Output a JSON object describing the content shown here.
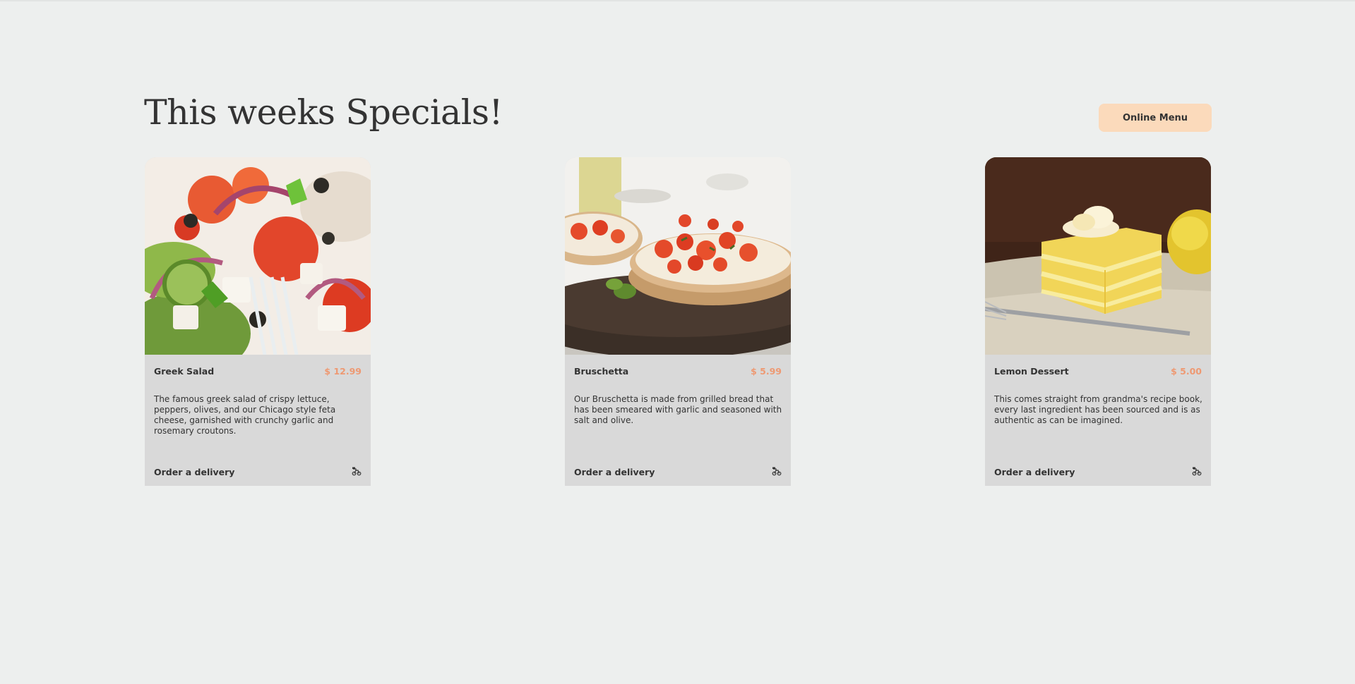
{
  "colors": {
    "page_bg": "#edefee",
    "accent_price": "#ee9972",
    "button_bg": "#fbdabb",
    "card_bg": "#d9d9d9",
    "text": "#333333"
  },
  "specials": {
    "title": "This weeks Specials!",
    "menu_button_label": "Online Menu",
    "cards": [
      {
        "name": "Greek Salad",
        "price": "$ 12.99",
        "description": "The famous greek salad of crispy lettuce, peppers, olives, and our Chicago style feta cheese, garnished with crunchy garlic and rosemary croutons.",
        "order_label": "Order a delivery",
        "order_icon": "delivery-bike-icon"
      },
      {
        "name": "Bruschetta",
        "price": "$ 5.99",
        "description": "Our Bruschetta is made from grilled bread that has been smeared with garlic and seasoned with salt and olive.",
        "order_label": "Order a delivery",
        "order_icon": "delivery-bike-icon"
      },
      {
        "name": "Lemon Dessert",
        "price": "$ 5.00",
        "description": "This comes straight from grandma's recipe book, every last ingredient has been sourced and is as authentic as can be imagined.",
        "order_label": "Order a delivery",
        "order_icon": "delivery-bike-icon"
      }
    ]
  }
}
